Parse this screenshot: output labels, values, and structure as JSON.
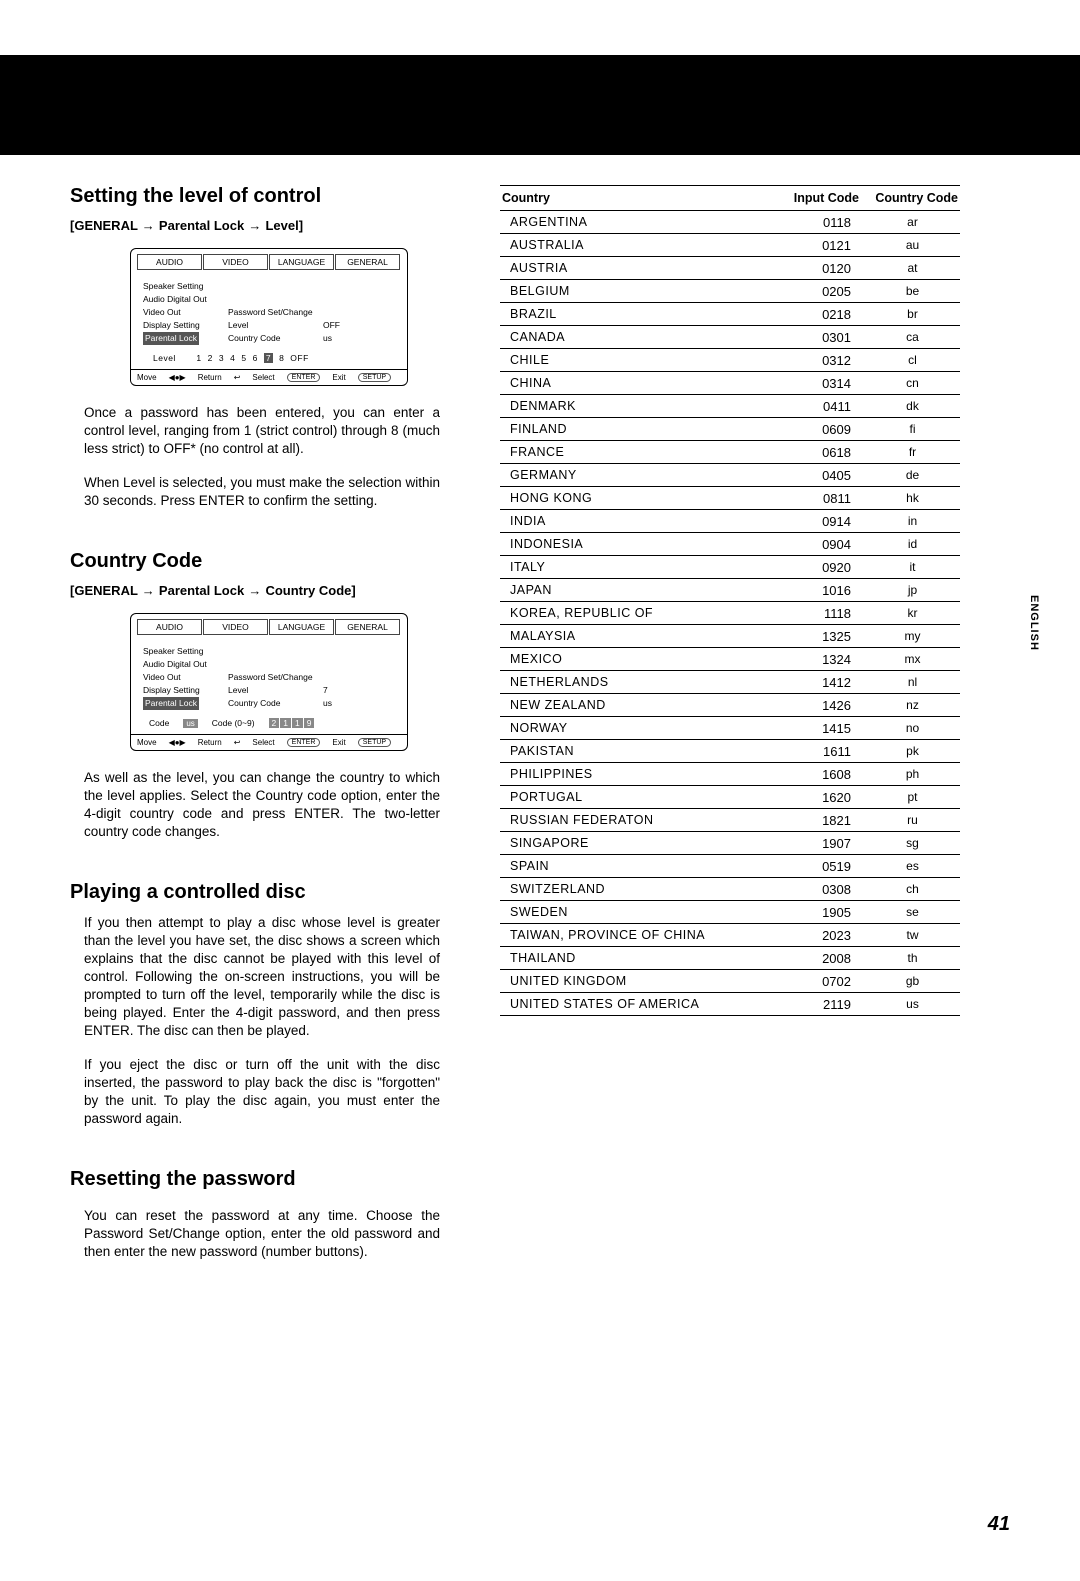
{
  "blackbar": true,
  "sidetab": "ENGLISH",
  "page_number": "41",
  "section1": {
    "heading": "Setting the level of control",
    "breadcrumb": [
      "GENERAL",
      "Parental Lock",
      "Level"
    ],
    "osd": {
      "tabs": [
        "AUDIO",
        "VIDEO",
        "LANGUAGE",
        "GENERAL"
      ],
      "left_items": [
        "Speaker Setting",
        "Audio Digital Out",
        "Video Out",
        "Display Setting",
        "Parental Lock"
      ],
      "mid_items": [
        "",
        "",
        "Password Set/Change",
        "Level",
        "Country Code"
      ],
      "right_items": [
        "",
        "",
        "",
        "OFF",
        "us"
      ],
      "highlighted_left": "Parental Lock",
      "level_label": "Level",
      "level_numbers": [
        "1",
        "2",
        "3",
        "4",
        "5",
        "6",
        "7",
        "8",
        "OFF"
      ],
      "level_highlight": "7",
      "footer": {
        "move": "Move",
        "return": "Return",
        "select": "Select",
        "select_btn": "ENTER",
        "exit": "Exit",
        "exit_btn": "SETUP"
      }
    },
    "para1": "Once a password has been entered, you can enter a control level, ranging from 1 (strict control) through 8 (much less strict) to OFF* (no control at all).",
    "para2": "When Level is selected, you must make the selection within 30 seconds. Press ENTER to confirm the setting."
  },
  "section2": {
    "heading": "Country Code",
    "breadcrumb": [
      "GENERAL",
      "Parental Lock",
      "Country Code"
    ],
    "osd": {
      "tabs": [
        "AUDIO",
        "VIDEO",
        "LANGUAGE",
        "GENERAL"
      ],
      "left_items": [
        "Speaker Setting",
        "Audio Digital Out",
        "Video Out",
        "Display Setting",
        "Parental Lock"
      ],
      "mid_items": [
        "",
        "",
        "Password Set/Change",
        "Level",
        "Country Code"
      ],
      "right_items": [
        "",
        "",
        "",
        "7",
        "us"
      ],
      "highlighted_left": "Parental Lock",
      "code_label": "Code",
      "code_value": "us",
      "code_range": "Code (0~9)",
      "code_digits": [
        "2",
        "1",
        "1",
        "9"
      ],
      "footer": {
        "move": "Move",
        "return": "Return",
        "select": "Select",
        "select_btn": "ENTER",
        "exit": "Exit",
        "exit_btn": "SETUP"
      }
    },
    "para1": "As well as the level, you can change the country to which the level applies. Select the Country code option, enter the 4-digit country code and press ENTER. The two-letter country code changes."
  },
  "section3": {
    "heading": "Playing a controlled disc",
    "para1": "If you then attempt to play a disc whose level is greater than the level you have set, the disc shows a screen which explains that the disc cannot be played with this level of control. Following the on-screen instructions, you will be prompted to turn off the level, temporarily while the disc is being played. Enter the 4-digit password, and then press ENTER. The disc can then be played.",
    "para2": "If you eject the disc or turn off the unit with the disc inserted, the password to play back the disc is \"forgotten\" by the unit. To play the disc again, you must enter the password again."
  },
  "section4": {
    "heading": "Resetting the password",
    "para1": "You can reset the password at any time. Choose the Password Set/Change option, enter the old password and then enter the new password (number buttons)."
  },
  "table": {
    "headers": [
      "Country",
      "Input Code",
      "Country Code"
    ],
    "rows": [
      [
        "ARGENTINA",
        "0118",
        "ar"
      ],
      [
        "AUSTRALIA",
        "0121",
        "au"
      ],
      [
        "AUSTRIA",
        "0120",
        "at"
      ],
      [
        "BELGIUM",
        "0205",
        "be"
      ],
      [
        "BRAZIL",
        "0218",
        "br"
      ],
      [
        "CANADA",
        "0301",
        "ca"
      ],
      [
        "CHILE",
        "0312",
        "cl"
      ],
      [
        "CHINA",
        "0314",
        "cn"
      ],
      [
        "DENMARK",
        "0411",
        "dk"
      ],
      [
        "FINLAND",
        "0609",
        "fi"
      ],
      [
        "FRANCE",
        "0618",
        "fr"
      ],
      [
        "GERMANY",
        "0405",
        "de"
      ],
      [
        "HONG KONG",
        "0811",
        "hk"
      ],
      [
        "INDIA",
        "0914",
        "in"
      ],
      [
        "INDONESIA",
        "0904",
        "id"
      ],
      [
        "ITALY",
        "0920",
        "it"
      ],
      [
        "JAPAN",
        "1016",
        "jp"
      ],
      [
        "KOREA, REPUBLIC OF",
        "1118",
        "kr"
      ],
      [
        "MALAYSIA",
        "1325",
        "my"
      ],
      [
        "MEXICO",
        "1324",
        "mx"
      ],
      [
        "NETHERLANDS",
        "1412",
        "nl"
      ],
      [
        "NEW ZEALAND",
        "1426",
        "nz"
      ],
      [
        "NORWAY",
        "1415",
        "no"
      ],
      [
        "PAKISTAN",
        "1611",
        "pk"
      ],
      [
        "PHILIPPINES",
        "1608",
        "ph"
      ],
      [
        "PORTUGAL",
        "1620",
        "pt"
      ],
      [
        "RUSSIAN FEDERATON",
        "1821",
        "ru"
      ],
      [
        "SINGAPORE",
        "1907",
        "sg"
      ],
      [
        "SPAIN",
        "0519",
        "es"
      ],
      [
        "SWITZERLAND",
        "0308",
        "ch"
      ],
      [
        "SWEDEN",
        "1905",
        "se"
      ],
      [
        "TAIWAN, PROVINCE OF CHINA",
        "2023",
        "tw"
      ],
      [
        "THAILAND",
        "2008",
        "th"
      ],
      [
        "UNITED KINGDOM",
        "0702",
        "gb"
      ],
      [
        "UNITED STATES OF AMERICA",
        "2119",
        "us"
      ]
    ]
  }
}
